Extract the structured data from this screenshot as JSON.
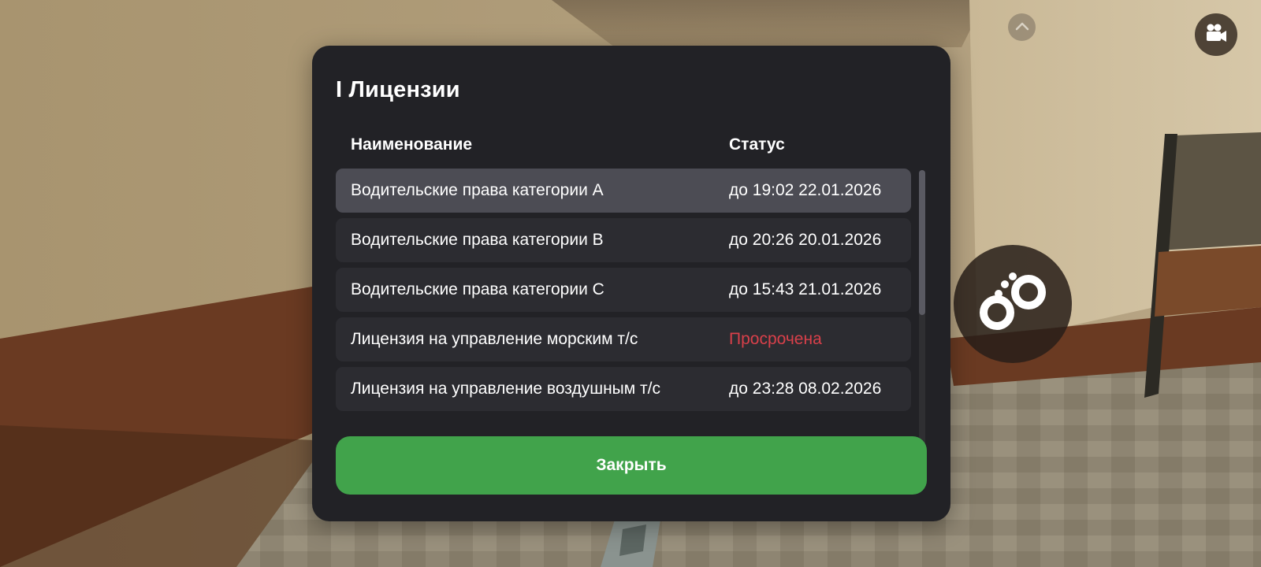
{
  "modal": {
    "title": "I Лицензии",
    "columns": {
      "name": "Наименование",
      "status": "Статус"
    },
    "rows": [
      {
        "name": "Водительские права категории A",
        "status": "до 19:02 22.01.2026",
        "selected": true,
        "expired": false
      },
      {
        "name": "Водительские права категории B",
        "status": "до 20:26 20.01.2026",
        "selected": false,
        "expired": false
      },
      {
        "name": "Водительские права категории C",
        "status": "до 15:43 21.01.2026",
        "selected": false,
        "expired": false
      },
      {
        "name": "Лицензия на управление морским т/с",
        "status": "Просрочена",
        "selected": false,
        "expired": true
      },
      {
        "name": "Лицензия на управление воздушным т/с",
        "status": "до 23:28 08.02.2026",
        "selected": false,
        "expired": false
      }
    ],
    "close_label": "Закрыть"
  },
  "colors": {
    "panel": "#222226",
    "row": "#2c2c31",
    "row_selected": "#4c4c54",
    "accent_green": "#41a34b",
    "expired_red": "#d9404a"
  },
  "hud": {
    "icons": [
      "chevron-up-icon",
      "video-camera-icon",
      "handcuffs-icon"
    ]
  }
}
